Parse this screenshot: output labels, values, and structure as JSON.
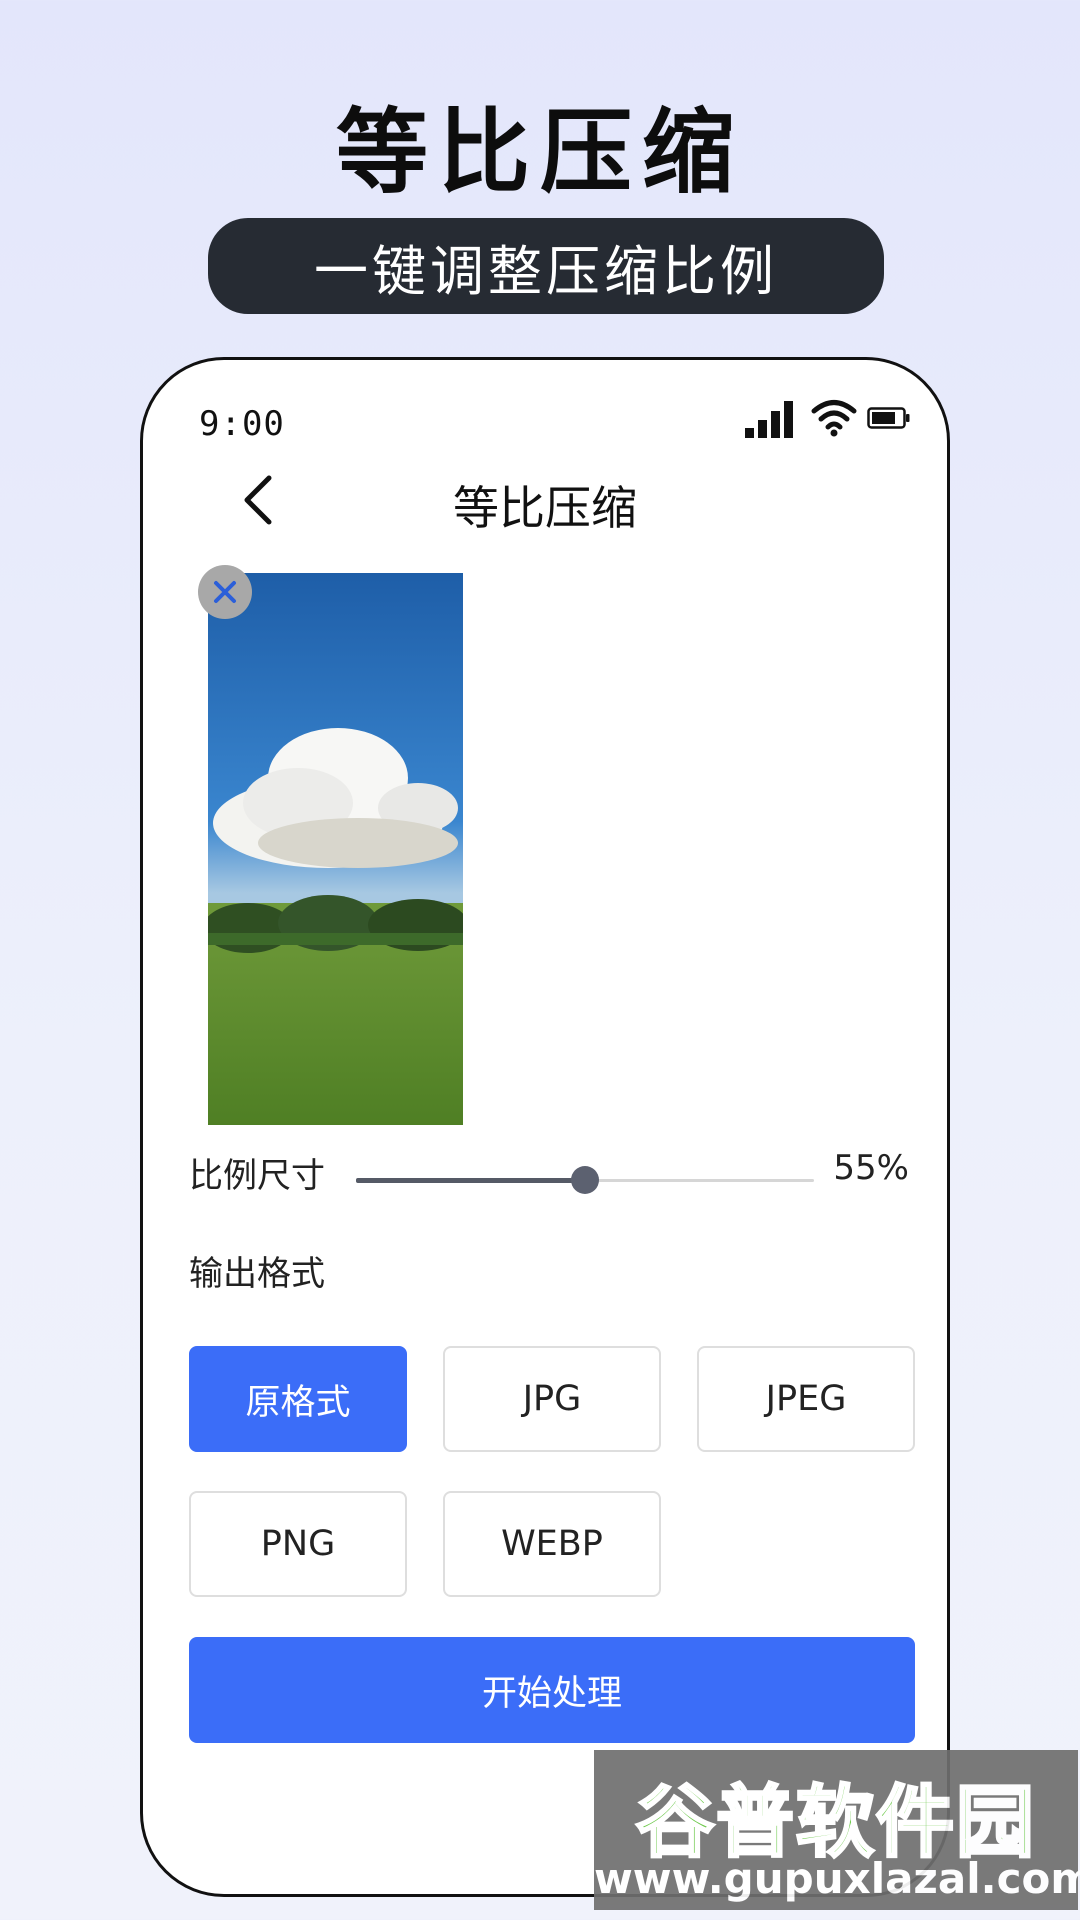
{
  "promo": {
    "title": "等比压缩",
    "subtitle": "一键调整压缩比例"
  },
  "status_bar": {
    "time": "9:00",
    "icons": [
      "signal-icon",
      "wifi-icon",
      "battery-icon"
    ]
  },
  "nav": {
    "back_icon": "chevron-left-icon",
    "title": "等比压缩"
  },
  "image": {
    "remove_icon": "close-icon"
  },
  "ratio": {
    "label": "比例尺寸",
    "value_text": "55%",
    "value": 0.5
  },
  "format": {
    "label": "输出格式",
    "options": [
      "原格式",
      "JPG",
      "JPEG",
      "PNG",
      "WEBP"
    ],
    "selected": "原格式"
  },
  "start_button": "开始处理",
  "watermark": {
    "name": "谷普软件园",
    "url": "www.gupuxlazal.com"
  },
  "colors": {
    "accent": "#3b6df8",
    "pill_bg": "#262b33",
    "slider_knob": "#5c6170"
  }
}
